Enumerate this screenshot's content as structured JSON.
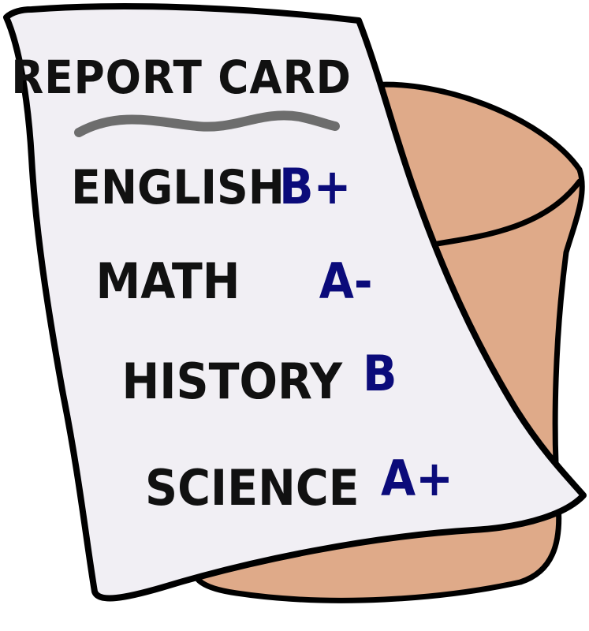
{
  "report_card": {
    "title": "REPORT CARD",
    "subjects": [
      {
        "name": "ENGLISH",
        "grade": "B+"
      },
      {
        "name": "MATH",
        "grade": "A-"
      },
      {
        "name": "HISTORY",
        "grade": "B"
      },
      {
        "name": "SCIENCE",
        "grade": "A+"
      }
    ]
  },
  "colors": {
    "paper": "#f1eff4",
    "outline": "#000000",
    "pot": "#dfaa89",
    "pot_inner": "#e4b294",
    "squiggle": "#6d6d6d",
    "subject_text": "#111111",
    "grade_text": "#0b0b7a"
  }
}
